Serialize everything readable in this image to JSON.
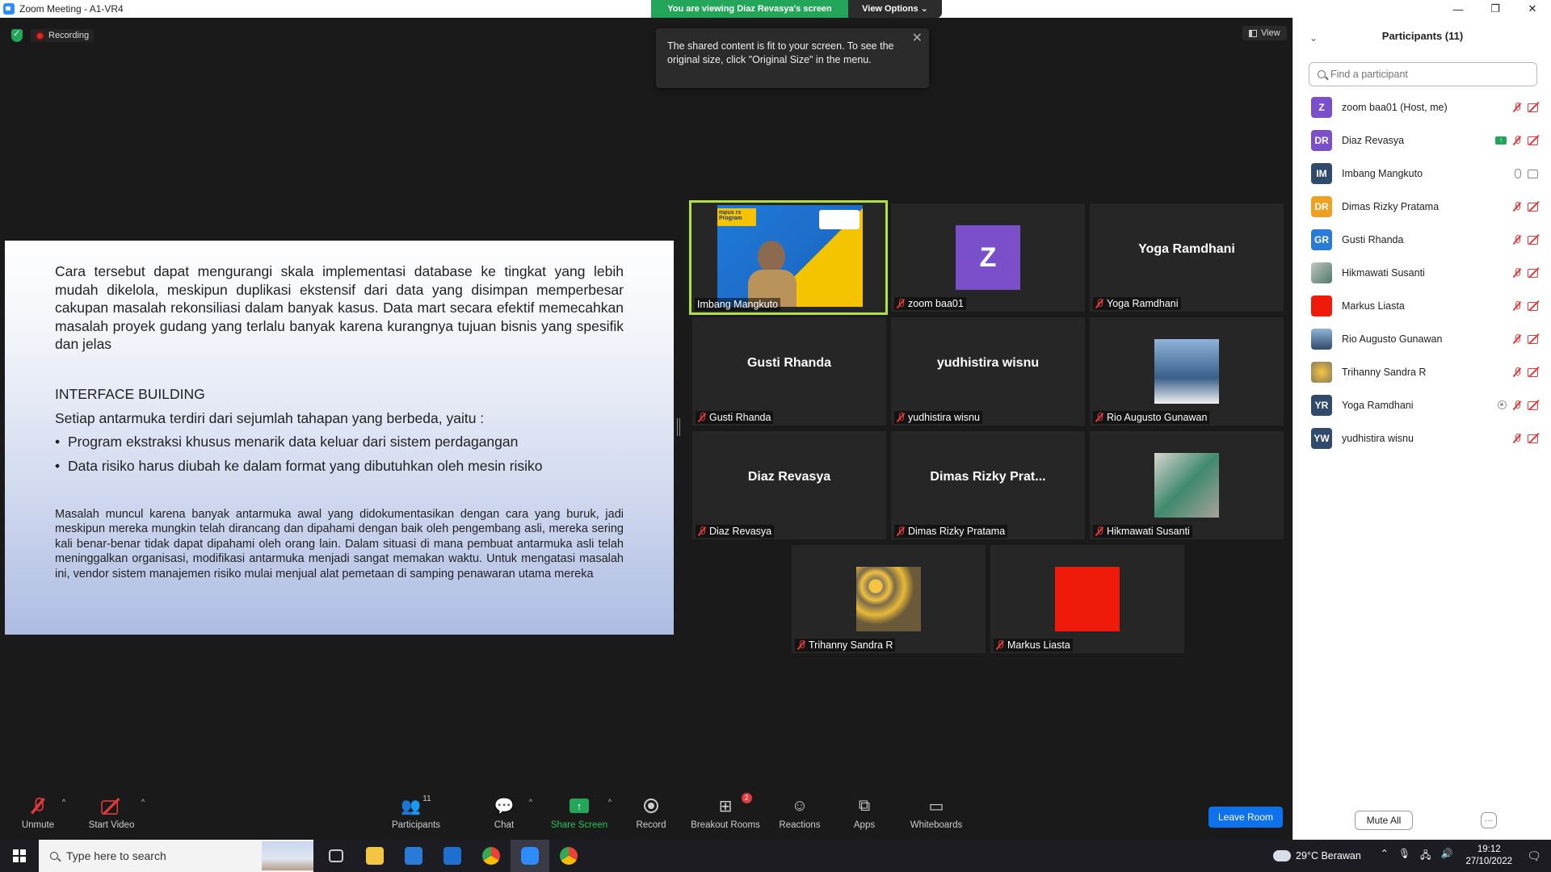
{
  "window": {
    "title": "Zoom Meeting - A1-VR4",
    "minimize": "—",
    "restore": "❐",
    "close": "✕"
  },
  "banner": {
    "viewing": "You are viewing Diaz Revasya's screen",
    "view_options": "View Options ⌄"
  },
  "status": {
    "recording": "Recording",
    "view": "View"
  },
  "tooltip": {
    "text": "The shared content is fit to your screen. To see the original size, click \"Original Size\" in the menu.",
    "close": "✕"
  },
  "slide": {
    "para1": "Cara tersebut dapat mengurangi skala implementasi database ke tingkat yang lebih mudah dikelola, meskipun duplikasi ekstensif dari data yang disimpan memperbesar cakupan masalah rekonsiliasi dalam banyak kasus. Data mart secara efektif memecahkan masalah proyek gudang yang terlalu banyak karena kurangnya tujuan bisnis yang spesifik dan jelas",
    "heading": "INTERFACE BUILDING",
    "intro": "Setiap antarmuka terdiri dari sejumlah tahapan yang berbeda, yaitu :",
    "bullets": [
      "Program ekstraksi khusus menarik data keluar dari sistem perdagangan",
      "Data risiko harus diubah ke dalam format yang dibutuhkan oleh mesin risiko"
    ],
    "para2": "Masalah muncul karena banyak antarmuka awal yang didokumentasikan dengan cara yang buruk, jadi meskipun mereka mungkin telah dirancang dan dipahami dengan baik oleh pengembang asli, mereka sering kali benar-benar tidak dapat dipahami oleh orang lain. Dalam situasi di mana pembuat antarmuka asli telah meninggalkan organisasi, modifikasi antarmuka menjadi sangat memakan waktu. Untuk mengatasi masalah ini, vendor sistem manajemen risiko mulai menjual alat pemetaan di samping penawaran utama mereka"
  },
  "video_logo": "mpus\nrs Program",
  "tiles": [
    {
      "name": "Imbang Mangkuto",
      "center": "",
      "kind": "video"
    },
    {
      "name": "zoom baa01",
      "center": "Z",
      "kind": "avatar",
      "color": "#7b4fc9"
    },
    {
      "name": "Yoga Ramdhani",
      "center": "Yoga Ramdhani",
      "kind": "text"
    },
    {
      "name": "Gusti Rhanda",
      "center": "Gusti Rhanda",
      "kind": "text"
    },
    {
      "name": "yudhistira wisnu",
      "center": "yudhistira wisnu",
      "kind": "text"
    },
    {
      "name": "Rio Augusto Gunawan",
      "center": "",
      "kind": "photo",
      "color": "#6a8fb5"
    },
    {
      "name": "Diaz Revasya",
      "center": "Diaz Revasya",
      "kind": "text"
    },
    {
      "name": "Dimas Rizky Pratama",
      "center": "Dimas Rizky Prat...",
      "kind": "text"
    },
    {
      "name": "Hikmawati Susanti",
      "center": "",
      "kind": "photo",
      "color": "#8c9a8a"
    },
    {
      "name": "Trihanny Sandra R",
      "center": "",
      "kind": "photo",
      "color": "#c9a24a"
    },
    {
      "name": "Markus Liasta",
      "center": "",
      "kind": "photo",
      "color": "#f01a0a"
    }
  ],
  "panel": {
    "title": "Participants (11)",
    "search_placeholder": "Find a participant",
    "participants": [
      {
        "initials": "Z",
        "name": "zoom baa01 (Host, me)",
        "color": "#7b4fc9",
        "mic": "off",
        "video": "off"
      },
      {
        "initials": "DR",
        "name": "Diaz Revasya",
        "color": "#7b4fc9",
        "mic": "off",
        "video": "off",
        "sharing": true
      },
      {
        "initials": "IM",
        "name": "Imbang Mangkuto",
        "color": "#2f4a6b",
        "mic": "on",
        "video": "on"
      },
      {
        "initials": "DR",
        "name": "Dimas Rizky Pratama",
        "color": "#f0a020",
        "mic": "off",
        "video": "off"
      },
      {
        "initials": "GR",
        "name": "Gusti Rhanda",
        "color": "#2a7ad8",
        "mic": "off",
        "video": "off"
      },
      {
        "initials": "",
        "name": "Hikmawati Susanti",
        "color": "#7a8a7a",
        "mic": "off",
        "video": "off"
      },
      {
        "initials": "",
        "name": "Markus Liasta",
        "color": "#f01a0a",
        "mic": "off",
        "video": "off"
      },
      {
        "initials": "",
        "name": "Rio Augusto Gunawan",
        "color": "#5a6d80",
        "mic": "off",
        "video": "off"
      },
      {
        "initials": "",
        "name": "Trihanny Sandra R",
        "color": "#c9a24a",
        "mic": "off",
        "video": "off"
      },
      {
        "initials": "YR",
        "name": "Yoga Ramdhani",
        "color": "#2f4a6b",
        "mic": "off",
        "video": "off",
        "hand": true
      },
      {
        "initials": "YW",
        "name": "yudhistira wisnu",
        "color": "#2f4a6b",
        "mic": "off",
        "video": "off"
      }
    ],
    "mute_all": "Mute All",
    "more": "···"
  },
  "toolbar": {
    "unmute": "Unmute",
    "start_video": "Start Video",
    "participants": "Participants",
    "participants_count": "11",
    "chat": "Chat",
    "share_screen": "Share Screen",
    "record": "Record",
    "breakout": "Breakout Rooms",
    "breakout_badge": "2",
    "reactions": "Reactions",
    "apps": "Apps",
    "whiteboards": "Whiteboards",
    "leave": "Leave Room"
  },
  "taskbar": {
    "search": "Type here to search",
    "weather": "29°C  Berawan",
    "time": "19:12",
    "date": "27/10/2022"
  }
}
